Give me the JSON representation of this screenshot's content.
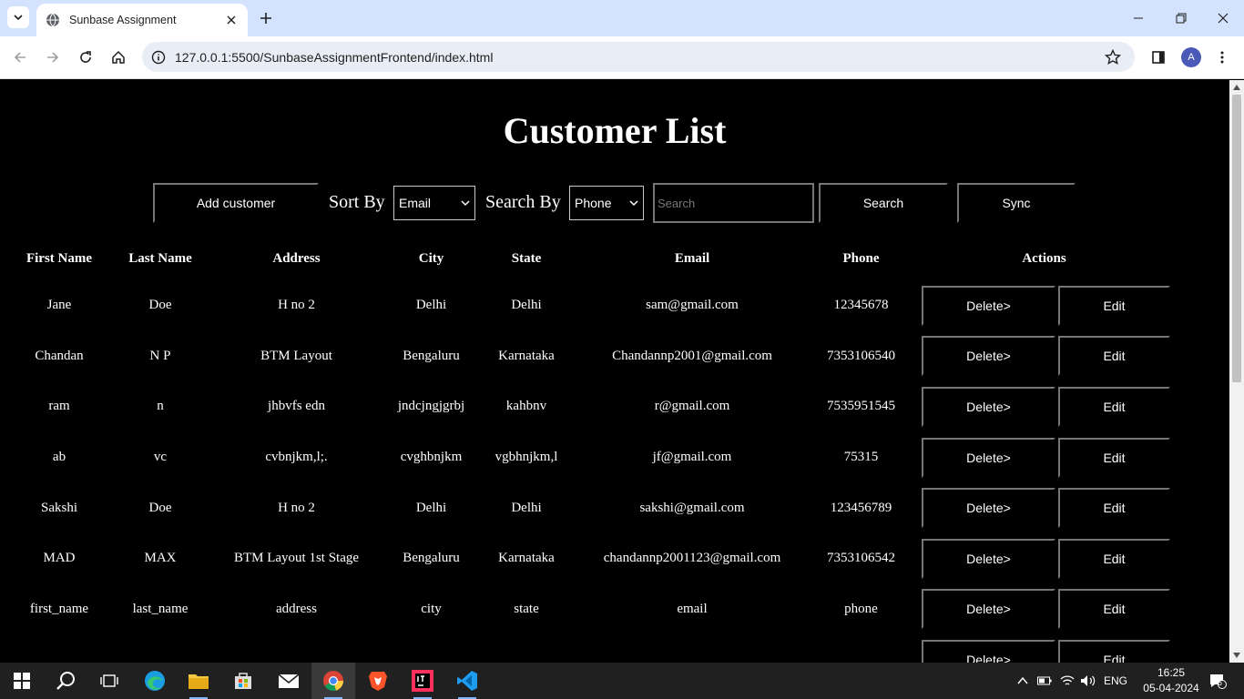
{
  "browser": {
    "tab_title": "Sunbase Assignment",
    "url": "127.0.0.1:5500/SunbaseAssignmentFrontend/index.html",
    "profile_initial": "A"
  },
  "page": {
    "title": "Customer List",
    "add_customer_label": "Add customer",
    "sort_by_label": "Sort By",
    "sort_by_value": "Email",
    "search_by_label": "Search By",
    "search_by_value": "Phone",
    "search_placeholder": "Search",
    "search_button_label": "Search",
    "sync_button_label": "Sync"
  },
  "table": {
    "headers": [
      "First Name",
      "Last Name",
      "Address",
      "City",
      "State",
      "Email",
      "Phone",
      "Actions"
    ],
    "delete_label": "Delete>",
    "edit_label": "Edit",
    "rows": [
      [
        "Jane",
        "Doe",
        "H no 2",
        "Delhi",
        "Delhi",
        "sam@gmail.com",
        "12345678"
      ],
      [
        "Chandan",
        "N P",
        "BTM Layout",
        "Bengaluru",
        "Karnataka",
        "Chandannp2001@gmail.com",
        "7353106540"
      ],
      [
        "ram",
        "n",
        "jhbvfs edn",
        "jndcjngjgrbj",
        "kahbnv",
        "r@gmail.com",
        "7535951545"
      ],
      [
        "ab",
        "vc",
        "cvbnjkm,l;.",
        "cvghbnjkm",
        "vgbhnjkm,l",
        "jf@gmail.com",
        "75315"
      ],
      [
        "Sakshi",
        "Doe",
        "H no 2",
        "Delhi",
        "Delhi",
        "sakshi@gmail.com",
        "123456789"
      ],
      [
        "MAD",
        "MAX",
        "BTM Layout 1st Stage",
        "Bengaluru",
        "Karnataka",
        "chandannp2001123@gmail.com",
        "7353106542"
      ],
      [
        "first_name",
        "last_name",
        "address",
        "city",
        "state",
        "email",
        "phone"
      ],
      [
        "",
        "",
        "",
        "",
        "",
        "",
        ""
      ]
    ]
  },
  "taskbar": {
    "language": "ENG",
    "time": "16:25",
    "date": "05-04-2024",
    "notification_count": "6"
  },
  "colors": {
    "page_background": "#000000",
    "tabstrip": "#d3e3fd",
    "taskbar": "#202020"
  }
}
